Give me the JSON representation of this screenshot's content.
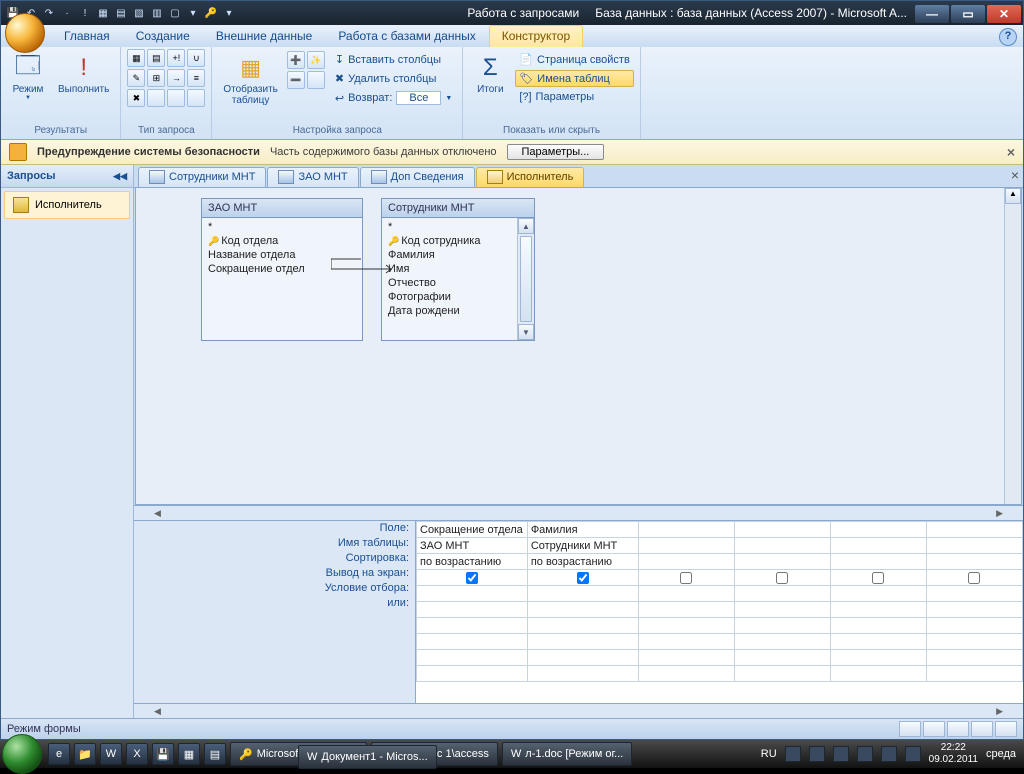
{
  "title": {
    "context": "Работа с запросами",
    "db": "База данных : база данных (Access 2007)  -  Microsoft A..."
  },
  "tabs": {
    "t1": "Главная",
    "t2": "Создание",
    "t3": "Внешние данные",
    "t4": "Работа с базами данных",
    "t5": "Конструктор"
  },
  "ribbon": {
    "g1": "Результаты",
    "g2": "Тип запроса",
    "g3": "Настройка запроса",
    "g4": "Показать или скрыть",
    "b_view": "Режим",
    "b_run": "Выполнить",
    "b_show": "Отобразить\nтаблицу",
    "b_totals": "Итоги",
    "s_insert": "Вставить столбцы",
    "s_delete": "Удалить столбцы",
    "s_return": "Возврат:",
    "s_ret_val": "Все",
    "p_prop": "Страница свойств",
    "p_names": "Имена таблиц",
    "p_params": "Параметры"
  },
  "security": {
    "title": "Предупреждение системы безопасности",
    "msg": "Часть содержимого базы данных отключено",
    "btn": "Параметры..."
  },
  "nav": {
    "header": "Запросы",
    "item": "Исполнитель"
  },
  "doctabs": {
    "t1": "Сотрудники МНТ",
    "t2": "ЗАО МНТ",
    "t3": "Доп Сведения",
    "t4": "Исполнитель"
  },
  "tables": {
    "a": {
      "name": "ЗАО МНТ",
      "star": "*",
      "f1": "Код отдела",
      "f2": "Название отдела",
      "f3": "Сокращение отдел"
    },
    "b": {
      "name": "Сотрудники МНТ",
      "star": "*",
      "f1": "Код сотрудника",
      "f2": "Фамилия",
      "f3": "Имя",
      "f4": "Отчество",
      "f5": "Фотографии",
      "f6": "Дата рождени"
    }
  },
  "grid": {
    "r_field": "Поле:",
    "r_table": "Имя таблицы:",
    "r_sort": "Сортировка:",
    "r_show": "Вывод на экран:",
    "r_crit": "Условие отбора:",
    "r_or": "или:",
    "c1": {
      "field": "Сокращение отдела",
      "table": "ЗАО МНТ",
      "sort": "по возрастанию"
    },
    "c2": {
      "field": "Фамилия",
      "table": "Сотрудники МНТ",
      "sort": "по возрастанию"
    }
  },
  "status": "Режим формы",
  "taskbar": {
    "b1": "Microsoft Access - ...",
    "b2": "E:\\1 курс 1\\access",
    "b3": "л-1.doc [Режим ог...",
    "b4": "Документ1 - Micros...",
    "lang": "RU",
    "time": "22:22",
    "date": "09.02.2011",
    "day": "среда"
  }
}
